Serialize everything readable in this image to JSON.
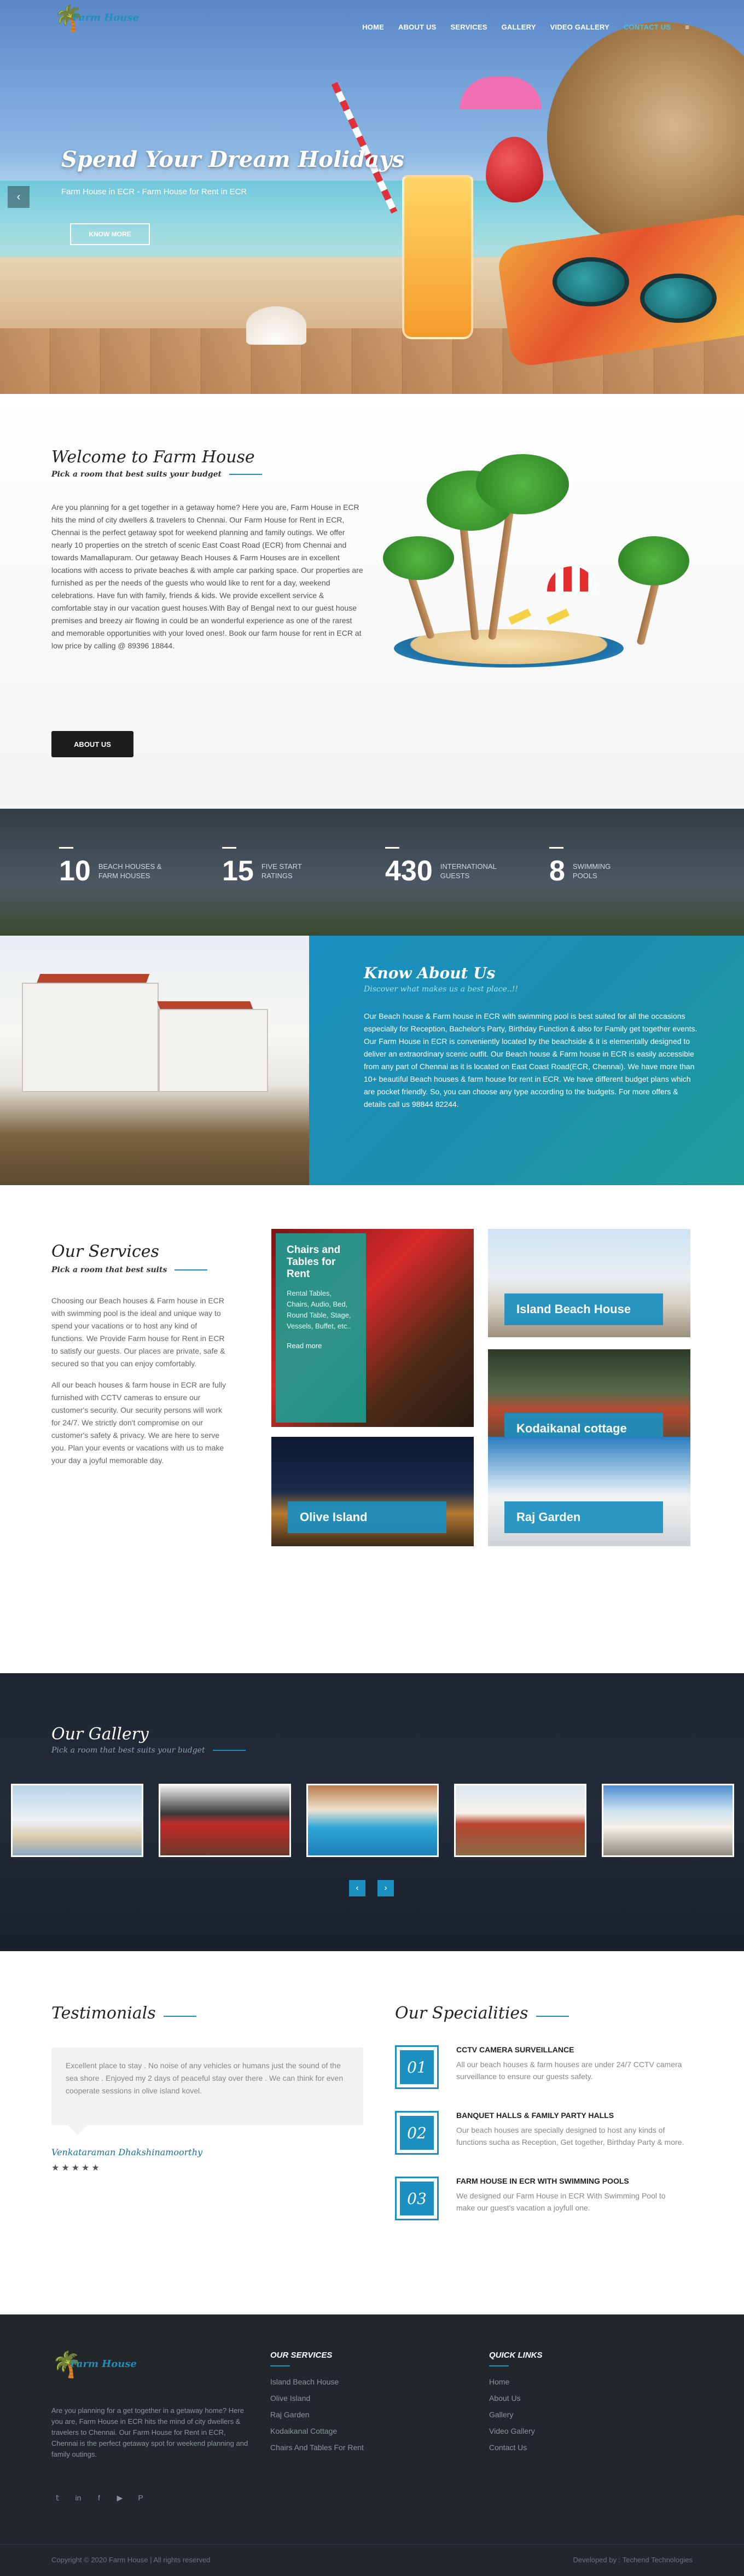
{
  "brand": {
    "name": "Farm House",
    "logo_icon": "palm-tree-icon"
  },
  "nav": {
    "items": [
      "HOME",
      "ABOUT US",
      "SERVICES",
      "GALLERY",
      "VIDEO GALLERY",
      "CONTACT US"
    ],
    "active": "CONTACT US",
    "menu_icon": "menu-icon"
  },
  "hero": {
    "title": "Spend Your Dream Holidays",
    "subtitle": "Farm House in ECR - Farm House for Rent in ECR",
    "button": "KNOW MORE",
    "prev_arrow": "‹"
  },
  "welcome": {
    "title": "Welcome to Farm House",
    "subtitle": "Pick a room that best suits your budget",
    "text": "Are you planning for a get together in a getaway home? Here you are, Farm House in ECR hits the mind of city dwellers & travelers to Chennai. Our Farm House for Rent in ECR, Chennai is the perfect getaway spot for weekend planning and family outings. We offer nearly 10 properties on the stretch of scenic East Coast Road (ECR) from Chennai and towards Mamallapuram. Our getaway Beach Houses & Farm Houses are in excellent locations with access to private beaches & with ample car parking space. Our properties are furnished as per the needs of the guests who would like to rent for a day, weekend celebrations. Have fun with family, friends & kids. We provide excellent service & comfortable stay in our vacation guest houses.With Bay of Bengal next to our guest house premises and breezy air flowing in could be an wonderful experience as one of the rarest and memorable opportunities with your loved ones!. Book our farm house for rent in ECR at low price by calling @ 89396 18844.",
    "button": "ABOUT US"
  },
  "stats": [
    {
      "num": "10",
      "line1": "BEACH HOUSES &",
      "line2": "FARM HOUSES"
    },
    {
      "num": "15",
      "line1": "FIVE START",
      "line2": "RATINGS"
    },
    {
      "num": "430",
      "line1": "INTERNATIONAL",
      "line2": "GUESTS"
    },
    {
      "num": "8",
      "line1": "SWIMMING",
      "line2": "POOLS"
    }
  ],
  "know": {
    "title": "Know About Us",
    "subtitle": "Discover what makes us a best place..!!",
    "text": "Our Beach house & Farm house in ECR with swimming pool is best suited for all the occasions especially for Reception, Bachelor's Party, Birthday Function & also for Family get together events. Our Farm House in ECR is conveniently located by the beachside & it is elementally designed to deliver an extraordinary scenic outfit. Our Beach house & Farm house in ECR is easily accessible from any part of Chennai as it is located on East Coast Road(ECR, Chennai). We have more than 10+ beautiful Beach houses & farm house for rent in ECR. We have different budget plans which are pocket friendly. So, you can choose any type according to the budgets. For more offers & details call us 98844 82244."
  },
  "services": {
    "title": "Our Services",
    "subtitle": "Pick a room that best suits",
    "p1": "Choosing our Beach houses & Farm house in ECR with swimming pool is the ideal and unique way to spend your vacations or to host any kind of functions. We Provide Farm house for Rent in ECR to satisfy our guests. Our places are private, safe & secured so that you can enjoy comfortably.",
    "p2": "All our beach houses & farm house in ECR are fully furnished with CCTV cameras to ensure our customer's security. Our security persons will work for 24/7. We strictly don't compromise on our customer's safety & privacy. We are here to serve you. Plan your events or vacations with us to make your day a joyful memorable day.",
    "chairs": {
      "title": "Chairs and Tables for Rent",
      "desc": "Rental Tables, Chairs, Audio, Bed, Round Table, Stage, Vessels, Buffet, etc..",
      "more": "Read more"
    },
    "cards": [
      "Island Beach House",
      "Kodaikanal cottage",
      "Olive Island",
      "Raj Garden"
    ]
  },
  "gallery": {
    "title": "Our Gallery",
    "subtitle": "Pick a room that best suits your budget",
    "prev": "‹",
    "next": "›"
  },
  "testimonials": {
    "title": "Testimonials",
    "quote": "Excellent place to stay . No noise of any vehicles or humans just the sound of the sea shore . Enjoyed my 2 days of peaceful stay over there . We can think for even cooperate sessions in olive island kovel.",
    "name": "Venkataraman Dhakshinamoorthy",
    "stars": "★★★★★"
  },
  "specialities": {
    "title": "Our Specialities",
    "items": [
      {
        "num": "01",
        "head": "CCTV CAMERA SURVEILLANCE",
        "desc": "All our beach houses & farm houses are under 24/7 CCTV camera surveillance to ensure our guests safety."
      },
      {
        "num": "02",
        "head": "BANQUET HALLS & FAMILY PARTY HALLS",
        "desc": "Our beach houses are specially designed to host any kinds of functions sucha as Reception, Get together, Birthday Party & more."
      },
      {
        "num": "03",
        "head": "FARM HOUSE IN ECR WITH SWIMMING POOLS",
        "desc": "We designed our Farm House in ECR With Swimming Pool to make our guest's vacation a joyfull one."
      }
    ]
  },
  "footer": {
    "about": "Are you planning for a get together in a getaway home? Here you are, Farm House in ECR hits the mind of city dwellers & travelers to Chennai. Our Farm House for Rent in ECR, Chennai is the perfect getaway spot for weekend planning and family outings.",
    "services_title": "OUR SERVICES",
    "services": [
      "Island Beach House",
      "Olive Island",
      "Raj Garden",
      "Kodaikanal Cottage",
      "Chairs And Tables For Rent"
    ],
    "links_title": "QUICK LINKS",
    "links": [
      "Home",
      "About Us",
      "Gallery",
      "Video Gallery",
      "Contact Us"
    ],
    "social_icons": [
      "twitter-icon",
      "linkedin-icon",
      "facebook-icon",
      "youtube-icon",
      "pinterest-icon"
    ],
    "copyright": "Copyright © 2020 Farm House | All rights reserved",
    "developer": "Developed by : Techend Technologies"
  },
  "colors": {
    "accent": "#1a8fc0",
    "teal": "#1e9d9c",
    "dark": "#22272c"
  }
}
